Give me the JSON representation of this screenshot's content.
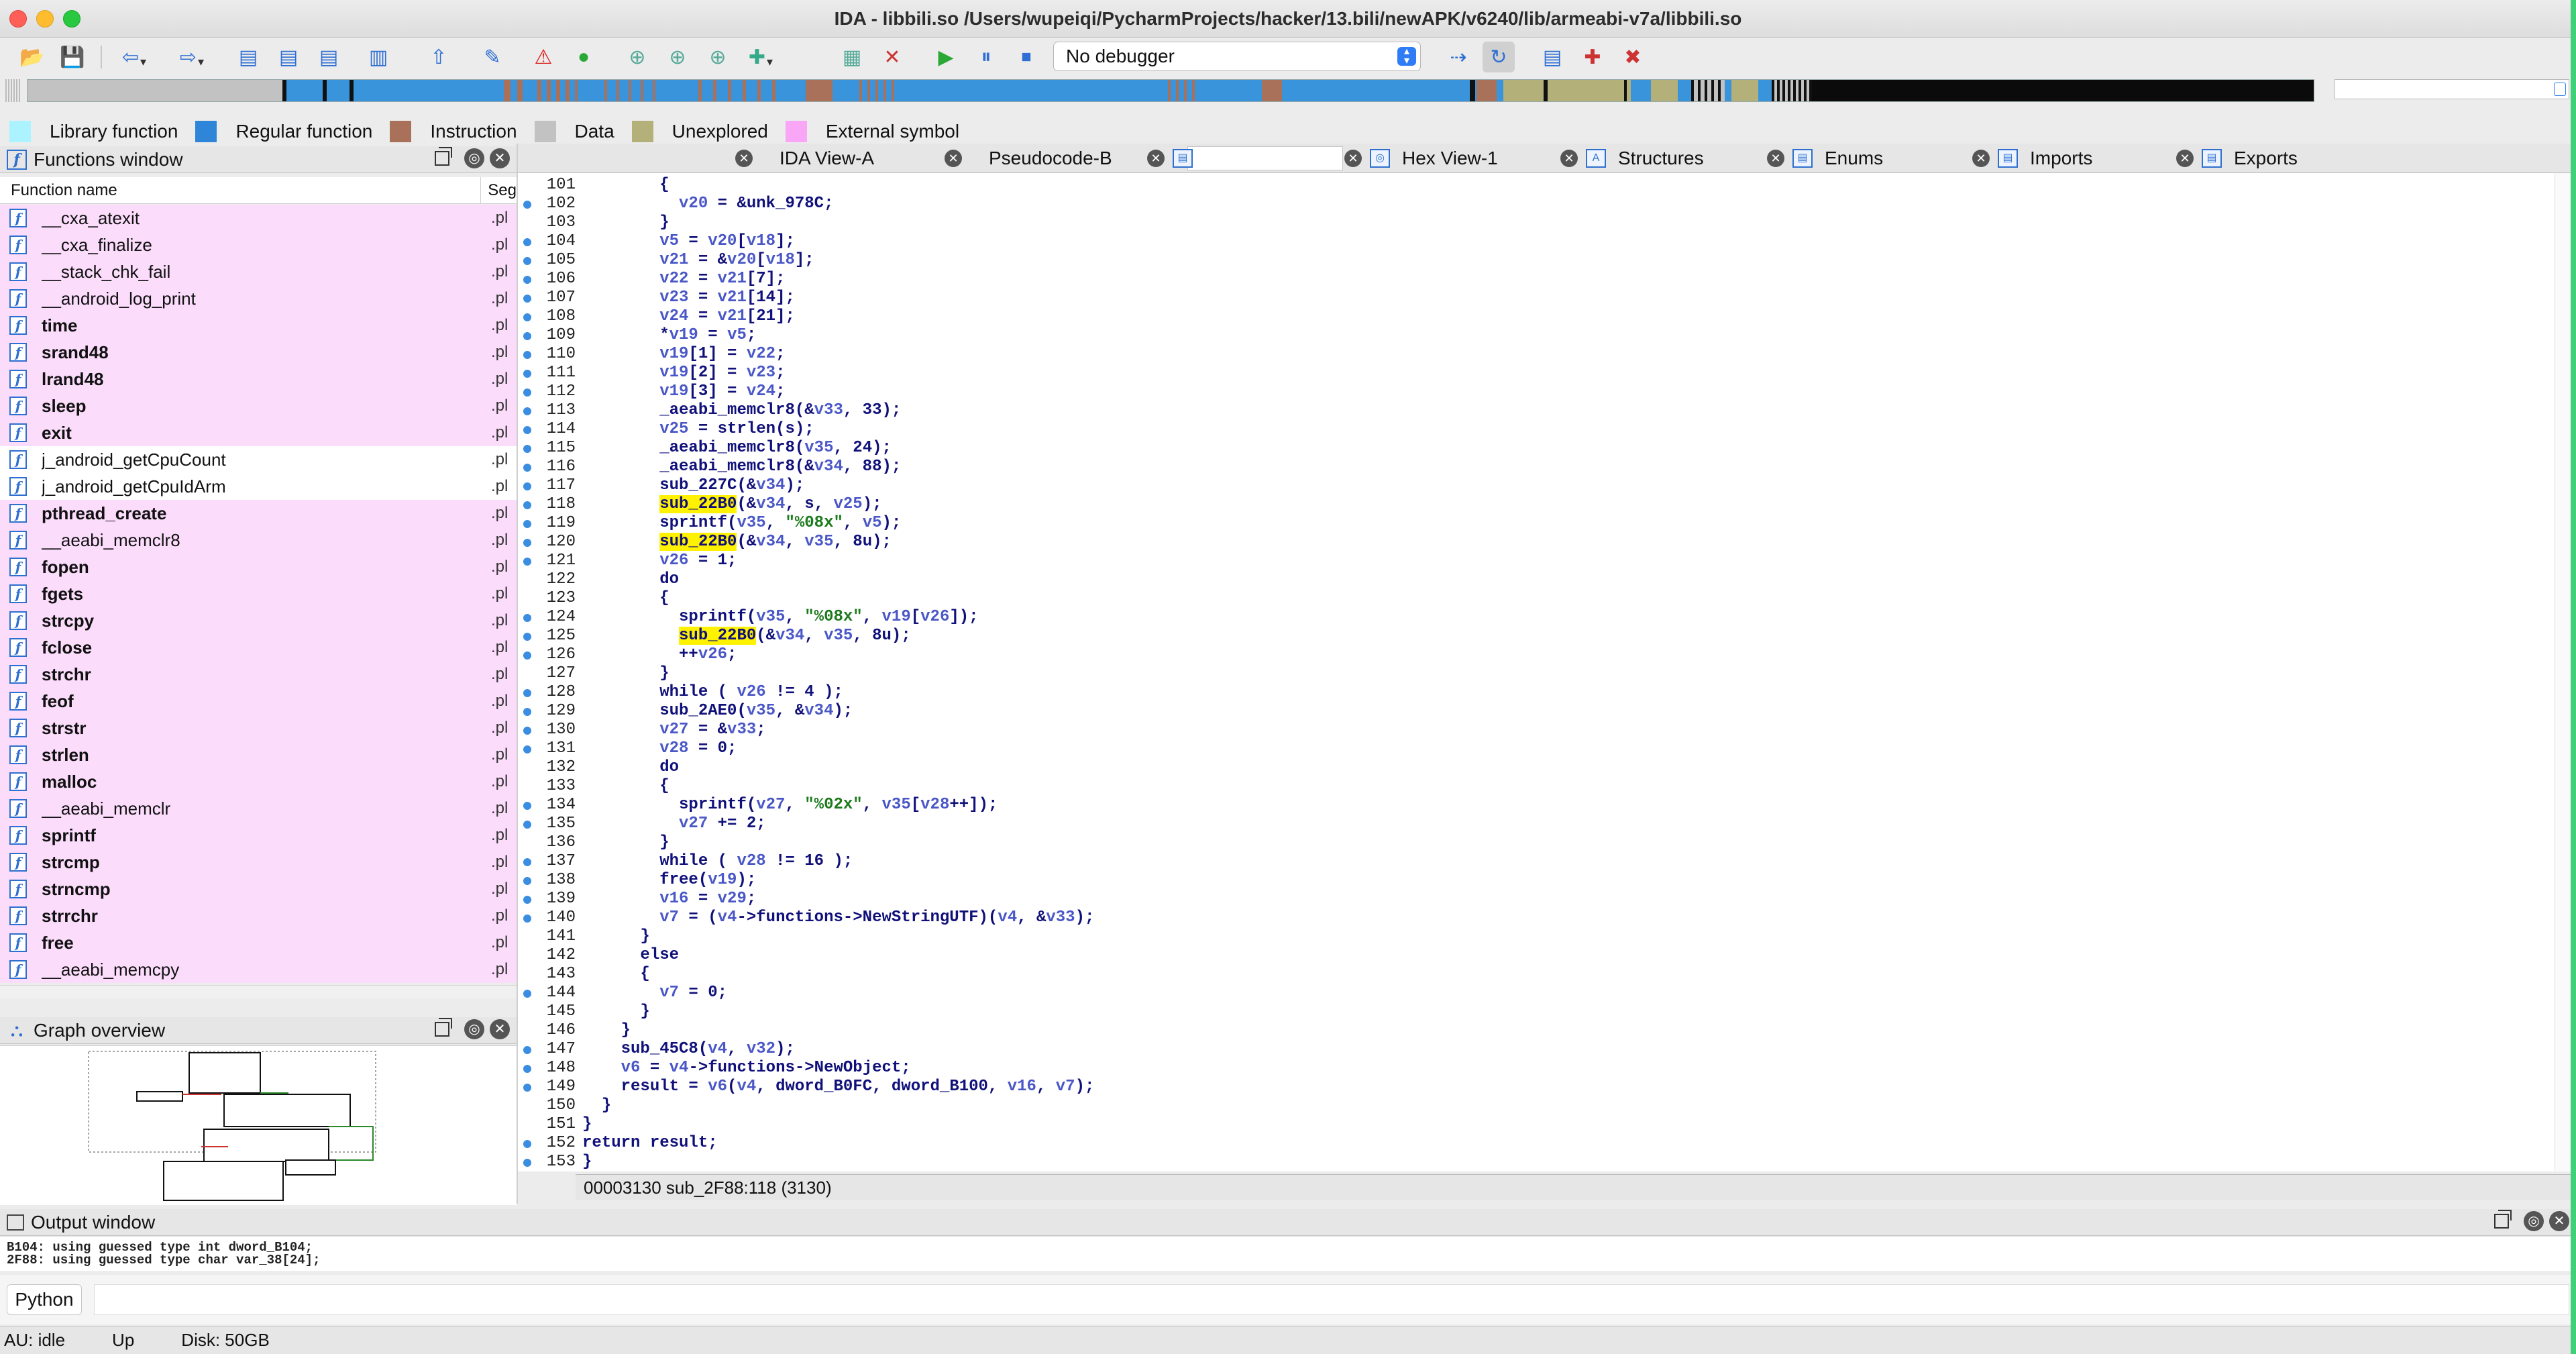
{
  "window": {
    "title": "IDA - libbili.so /Users/wupeiqi/PycharmProjects/hacker/13.bili/newAPK/v6240/lib/armeabi-v7a/libbili.so"
  },
  "toolbar": {
    "debugger_select": "No debugger"
  },
  "legend": [
    {
      "label": "Library function",
      "color": "#aaf3ff"
    },
    {
      "label": "Regular function",
      "color": "#2f86d8"
    },
    {
      "label": "Instruction",
      "color": "#a9715a"
    },
    {
      "label": "Data",
      "color": "#c2c2c2"
    },
    {
      "label": "Unexplored",
      "color": "#b3b07a"
    },
    {
      "label": "External symbol",
      "color": "#f8a6f5"
    }
  ],
  "functions_window": {
    "title": "Functions window",
    "col_name": "Function name",
    "col_seg": "Seg",
    "rows": [
      {
        "name": "__cxa_atexit",
        "seg": ".pl",
        "style": "pink",
        "bold": false
      },
      {
        "name": "__cxa_finalize",
        "seg": ".pl",
        "style": "pink",
        "bold": false
      },
      {
        "name": "__stack_chk_fail",
        "seg": ".pl",
        "style": "pink",
        "bold": false
      },
      {
        "name": "__android_log_print",
        "seg": ".pl",
        "style": "pink",
        "bold": false
      },
      {
        "name": "time",
        "seg": ".pl",
        "style": "pink",
        "bold": true
      },
      {
        "name": "srand48",
        "seg": ".pl",
        "style": "pink",
        "bold": true
      },
      {
        "name": "lrand48",
        "seg": ".pl",
        "style": "pink",
        "bold": true
      },
      {
        "name": "sleep",
        "seg": ".pl",
        "style": "pink",
        "bold": true
      },
      {
        "name": "exit",
        "seg": ".pl",
        "style": "pink",
        "bold": true
      },
      {
        "name": "j_android_getCpuCount",
        "seg": ".pl",
        "style": "white",
        "bold": false
      },
      {
        "name": "j_android_getCpuIdArm",
        "seg": ".pl",
        "style": "white",
        "bold": false
      },
      {
        "name": "pthread_create",
        "seg": ".pl",
        "style": "pink",
        "bold": true
      },
      {
        "name": "__aeabi_memclr8",
        "seg": ".pl",
        "style": "pink",
        "bold": false
      },
      {
        "name": "fopen",
        "seg": ".pl",
        "style": "pink",
        "bold": true
      },
      {
        "name": "fgets",
        "seg": ".pl",
        "style": "pink",
        "bold": true
      },
      {
        "name": "strcpy",
        "seg": ".pl",
        "style": "pink",
        "bold": true
      },
      {
        "name": "fclose",
        "seg": ".pl",
        "style": "pink",
        "bold": true
      },
      {
        "name": "strchr",
        "seg": ".pl",
        "style": "pink",
        "bold": true
      },
      {
        "name": "feof",
        "seg": ".pl",
        "style": "pink",
        "bold": true
      },
      {
        "name": "strstr",
        "seg": ".pl",
        "style": "pink",
        "bold": true
      },
      {
        "name": "strlen",
        "seg": ".pl",
        "style": "pink",
        "bold": true
      },
      {
        "name": "malloc",
        "seg": ".pl",
        "style": "pink",
        "bold": true
      },
      {
        "name": "__aeabi_memclr",
        "seg": ".pl",
        "style": "pink",
        "bold": false
      },
      {
        "name": "sprintf",
        "seg": ".pl",
        "style": "pink",
        "bold": true
      },
      {
        "name": "strcmp",
        "seg": ".pl",
        "style": "pink",
        "bold": true
      },
      {
        "name": "strncmp",
        "seg": ".pl",
        "style": "pink",
        "bold": true
      },
      {
        "name": "strrchr",
        "seg": ".pl",
        "style": "pink",
        "bold": true
      },
      {
        "name": "free",
        "seg": ".pl",
        "style": "pink",
        "bold": true
      },
      {
        "name": "__aeabi_memcpy",
        "seg": ".pl",
        "style": "pink",
        "bold": false
      }
    ]
  },
  "graph_overview": {
    "title": "Graph overview"
  },
  "tabs": [
    {
      "label": "IDA View-A"
    },
    {
      "label": "Pseudocode-B"
    },
    {
      "label": ""
    },
    {
      "label": "Hex View-1"
    },
    {
      "label": "Structures"
    },
    {
      "label": "Enums"
    },
    {
      "label": "Imports"
    },
    {
      "label": "Exports"
    }
  ],
  "code": [
    {
      "n": "101",
      "dot": false,
      "t": "        {"
    },
    {
      "n": "102",
      "dot": true,
      "t": "          v20 = &unk_978C;"
    },
    {
      "n": "103",
      "dot": false,
      "t": "        }"
    },
    {
      "n": "104",
      "dot": true,
      "t": "        v5 = v20[v18];"
    },
    {
      "n": "105",
      "dot": true,
      "t": "        v21 = &v20[v18];"
    },
    {
      "n": "106",
      "dot": true,
      "t": "        v22 = v21[7];"
    },
    {
      "n": "107",
      "dot": true,
      "t": "        v23 = v21[14];"
    },
    {
      "n": "108",
      "dot": true,
      "t": "        v24 = v21[21];"
    },
    {
      "n": "109",
      "dot": true,
      "t": "        *v19 = v5;"
    },
    {
      "n": "110",
      "dot": true,
      "t": "        v19[1] = v22;"
    },
    {
      "n": "111",
      "dot": true,
      "t": "        v19[2] = v23;"
    },
    {
      "n": "112",
      "dot": true,
      "t": "        v19[3] = v24;"
    },
    {
      "n": "113",
      "dot": true,
      "t": "        _aeabi_memclr8(&v33, 33);"
    },
    {
      "n": "114",
      "dot": true,
      "t": "        v25 = strlen(s);"
    },
    {
      "n": "115",
      "dot": true,
      "t": "        _aeabi_memclr8(v35, 24);"
    },
    {
      "n": "116",
      "dot": true,
      "t": "        _aeabi_memclr8(&v34, 88);"
    },
    {
      "n": "117",
      "dot": true,
      "t": "        sub_227C(&v34);"
    },
    {
      "n": "118",
      "dot": true,
      "t": "        sub_22B0(&v34, s, v25);"
    },
    {
      "n": "119",
      "dot": true,
      "t": "        sprintf(v35, \"%08x\", v5);"
    },
    {
      "n": "120",
      "dot": true,
      "t": "        sub_22B0(&v34, v35, 8u);"
    },
    {
      "n": "121",
      "dot": true,
      "t": "        v26 = 1;"
    },
    {
      "n": "122",
      "dot": false,
      "t": "        do"
    },
    {
      "n": "123",
      "dot": false,
      "t": "        {"
    },
    {
      "n": "124",
      "dot": true,
      "t": "          sprintf(v35, \"%08x\", v19[v26]);"
    },
    {
      "n": "125",
      "dot": true,
      "t": "          sub_22B0(&v34, v35, 8u);"
    },
    {
      "n": "126",
      "dot": true,
      "t": "          ++v26;"
    },
    {
      "n": "127",
      "dot": false,
      "t": "        }"
    },
    {
      "n": "128",
      "dot": true,
      "t": "        while ( v26 != 4 );"
    },
    {
      "n": "129",
      "dot": true,
      "t": "        sub_2AE0(v35, &v34);"
    },
    {
      "n": "130",
      "dot": true,
      "t": "        v27 = &v33;"
    },
    {
      "n": "131",
      "dot": true,
      "t": "        v28 = 0;"
    },
    {
      "n": "132",
      "dot": false,
      "t": "        do"
    },
    {
      "n": "133",
      "dot": false,
      "t": "        {"
    },
    {
      "n": "134",
      "dot": true,
      "t": "          sprintf(v27, \"%02x\", v35[v28++]);"
    },
    {
      "n": "135",
      "dot": true,
      "t": "          v27 += 2;"
    },
    {
      "n": "136",
      "dot": false,
      "t": "        }"
    },
    {
      "n": "137",
      "dot": true,
      "t": "        while ( v28 != 16 );"
    },
    {
      "n": "138",
      "dot": true,
      "t": "        free(v19);"
    },
    {
      "n": "139",
      "dot": true,
      "t": "        v16 = v29;"
    },
    {
      "n": "140",
      "dot": true,
      "t": "        v7 = (v4->functions->NewStringUTF)(v4, &v33);"
    },
    {
      "n": "141",
      "dot": false,
      "t": "      }"
    },
    {
      "n": "142",
      "dot": false,
      "t": "      else"
    },
    {
      "n": "143",
      "dot": false,
      "t": "      {"
    },
    {
      "n": "144",
      "dot": true,
      "t": "        v7 = 0;"
    },
    {
      "n": "145",
      "dot": false,
      "t": "      }"
    },
    {
      "n": "146",
      "dot": false,
      "t": "    }"
    },
    {
      "n": "147",
      "dot": true,
      "t": "    sub_45C8(v4, v32);"
    },
    {
      "n": "148",
      "dot": true,
      "t": "    v6 = v4->functions->NewObject;"
    },
    {
      "n": "149",
      "dot": true,
      "t": "    result = v6(v4, dword_B0FC, dword_B100, v16, v7);"
    },
    {
      "n": "150",
      "dot": false,
      "t": "  }"
    },
    {
      "n": "151",
      "dot": false,
      "t": "}"
    },
    {
      "n": "152",
      "dot": true,
      "t": "return result;"
    },
    {
      "n": "153",
      "dot": true,
      "t": "}"
    }
  ],
  "code_status": "00003130 sub_2F88:118 (3130)",
  "output_window": {
    "title": "Output window",
    "lines": [
      "B104: using guessed type int dword_B104;",
      "2F88: using guessed type char var_38[24];"
    ]
  },
  "python_button": "Python",
  "statusbar": {
    "au": "AU:  idle",
    "dir": "Up",
    "disk": "Disk: 50GB"
  }
}
